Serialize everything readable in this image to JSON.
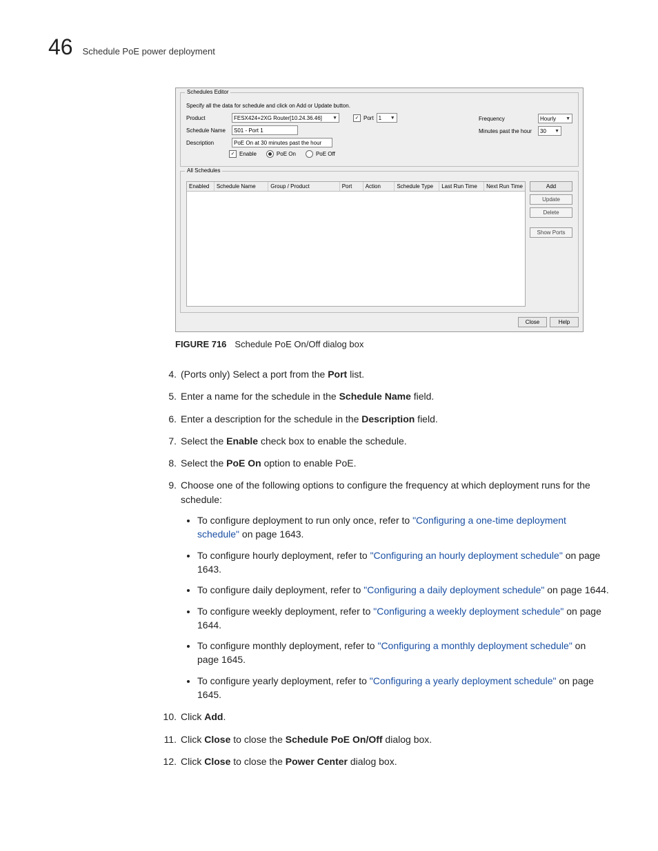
{
  "header": {
    "chapter_number": "46",
    "chapter_title": "Schedule PoE power deployment"
  },
  "dialog": {
    "editor_legend": "Schedules Editor",
    "instruction": "Specify all the data for schedule and click on Add or Update button.",
    "product_label": "Product",
    "product_value": "FESX424+2XG Router[10.24.36.46]",
    "port_chk_label": "Port",
    "port_value": "1",
    "schedule_name_label": "Schedule Name",
    "schedule_name_value": "S01 - Port 1",
    "description_label": "Description",
    "description_value": "PoE On at 30 minutes past the hour",
    "enable_label": "Enable",
    "poe_on_label": "PoE On",
    "poe_off_label": "PoE Off",
    "frequency_label": "Frequency",
    "frequency_value": "Hourly",
    "minutes_label": "Minutes past the hour",
    "minutes_value": "30",
    "all_schedules_legend": "All Schedules",
    "columns": [
      "Enabled",
      "Schedule Name",
      "Group / Product",
      "Port",
      "Action",
      "Schedule Type",
      "Last Run Time",
      "Next Run Time"
    ],
    "buttons": {
      "add": "Add",
      "update": "Update",
      "delete": "Delete",
      "show_ports": "Show Ports",
      "close": "Close",
      "help": "Help"
    }
  },
  "figure": {
    "number": "FIGURE 716",
    "caption": "Schedule PoE On/Off dialog box"
  },
  "steps": [
    {
      "pre": "(Ports only) Select a port from the ",
      "bold": "Port",
      "post": " list."
    },
    {
      "pre": "Enter a name for the schedule in the ",
      "bold": "Schedule Name",
      "post": " field."
    },
    {
      "pre": "Enter a description for the schedule in the ",
      "bold": "Description",
      "post": " field."
    },
    {
      "pre": "Select the ",
      "bold": "Enable",
      "post": " check box to enable the schedule."
    },
    {
      "pre": "Select the ",
      "bold": "PoE On",
      "post": " option to enable PoE."
    }
  ],
  "step9": {
    "lead": "Choose one of the following options to configure the frequency at which deployment runs for the schedule:",
    "items": [
      {
        "pre": "To configure deployment to run only once, refer to ",
        "link": "\"Configuring a one-time deployment schedule\"",
        "post": " on page 1643."
      },
      {
        "pre": "To configure hourly deployment, refer to ",
        "link": "\"Configuring an hourly deployment schedule\"",
        "post": " on page 1643."
      },
      {
        "pre": "To configure daily deployment, refer to ",
        "link": "\"Configuring a daily deployment schedule\"",
        "post": " on page 1644."
      },
      {
        "pre": "To configure weekly deployment, refer to ",
        "link": "\"Configuring a weekly deployment schedule\"",
        "post": " on page 1644."
      },
      {
        "pre": "To configure monthly deployment, refer to ",
        "link": "\"Configuring a monthly deployment schedule\"",
        "post": " on page 1645."
      },
      {
        "pre": "To configure yearly deployment, refer to ",
        "link": "\"Configuring a yearly deployment schedule\"",
        "post": " on page 1645."
      }
    ]
  },
  "step10": {
    "pre": "Click ",
    "bold": "Add",
    "post": "."
  },
  "step11": {
    "pre": "Click ",
    "bold1": "Close",
    "mid": " to close the ",
    "bold2": "Schedule PoE On/Off",
    "post": " dialog box."
  },
  "step12": {
    "pre": "Click ",
    "bold1": "Close",
    "mid": " to close the ",
    "bold2": "Power Center",
    "post": " dialog box."
  }
}
